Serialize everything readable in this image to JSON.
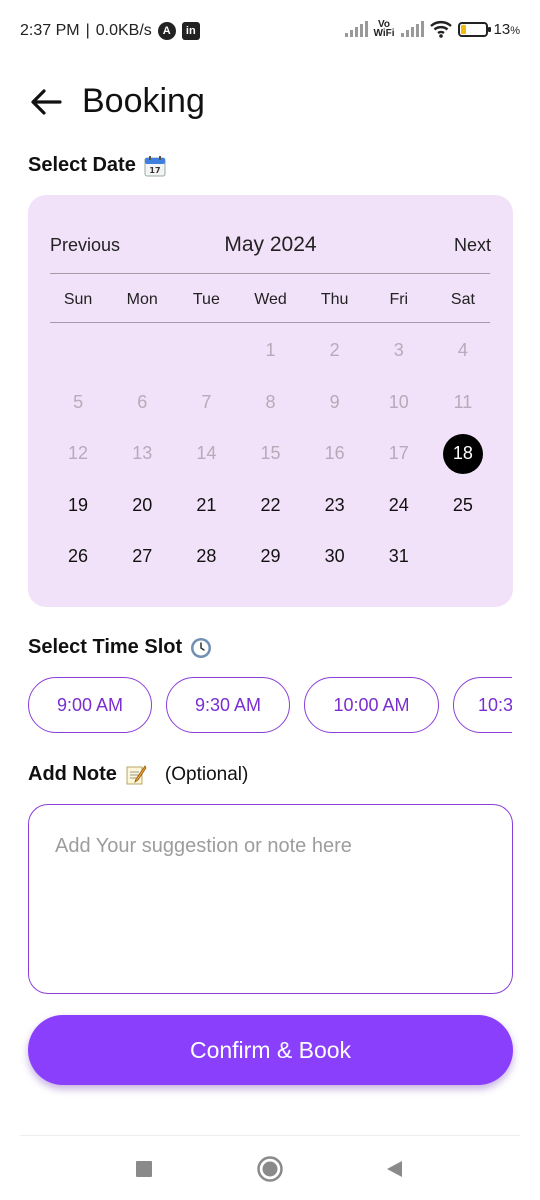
{
  "status_bar": {
    "time": "2:37 PM",
    "speed": "0.0KB/s",
    "wifi_label_top": "Vo",
    "wifi_label_bottom": "WiFi",
    "battery_percent": "13",
    "battery_sign": "%",
    "separator": "|"
  },
  "header": {
    "title": "Booking"
  },
  "date_section": {
    "label": "Select Date"
  },
  "calendar": {
    "previous": "Previous",
    "next": "Next",
    "month": "May 2024",
    "weekdays": [
      "Sun",
      "Mon",
      "Tue",
      "Wed",
      "Thu",
      "Fri",
      "Sat"
    ],
    "leading_blanks": 3,
    "days_in_month": 31,
    "selected_day": 18,
    "first_selectable_day": 18
  },
  "time_section": {
    "label": "Select Time Slot",
    "slots": [
      "9:00 AM",
      "9:30 AM",
      "10:00 AM",
      "10:3"
    ]
  },
  "note_section": {
    "label": "Add Note",
    "optional": "(Optional)",
    "placeholder": "Add Your suggestion or note here",
    "value": ""
  },
  "confirm": {
    "label": "Confirm & Book"
  },
  "colors": {
    "accent": "#8a3ffc",
    "calendar_bg": "#f2e2f9",
    "selected_day_bg": "#000000",
    "disabled_day": "#b7aab9"
  },
  "icons": {
    "back": "arrow-left-icon",
    "calendar_emoji": "calendar-icon",
    "clock_emoji": "clock-icon",
    "note_emoji": "memo-icon",
    "nav_recents": "square-icon",
    "nav_home": "circle-icon",
    "nav_back": "triangle-back-icon"
  }
}
